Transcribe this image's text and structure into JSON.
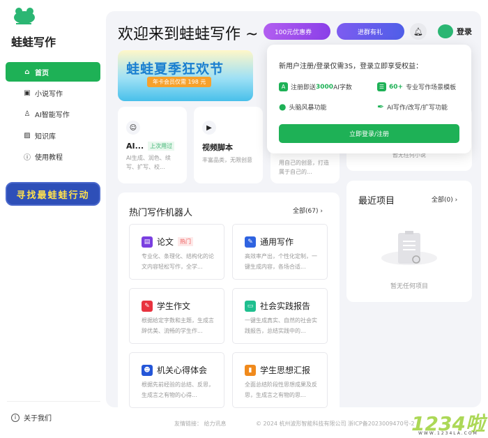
{
  "sidebar": {
    "brand": "蛙蛙写作",
    "items": [
      {
        "label": "首页",
        "icon": "home-icon"
      },
      {
        "label": "小说写作",
        "icon": "novel-icon"
      },
      {
        "label": "AI智能写作",
        "icon": "robot-icon"
      },
      {
        "label": "知识库",
        "icon": "image-icon"
      },
      {
        "label": "使用教程",
        "icon": "info-icon"
      }
    ],
    "promo": "寻找最蛙蛙行动",
    "about": "关于我们"
  },
  "header": {
    "title": "欢迎来到蛙蛙写作 ~",
    "coupon": "100元优惠券",
    "group": "进群有礼",
    "login": "登录"
  },
  "banner": {
    "title": "蛙蛙夏季狂欢节",
    "sub": "年卡会员仅需 198 元"
  },
  "quick": [
    {
      "name": "AI...",
      "tag": "上次用过",
      "desc": "AI生成、润色、续写、扩写、校..."
    },
    {
      "name": "视频脚本",
      "desc": "丰富品类，无限创意"
    },
    {
      "desc": "用自己的创意，打造属于自己的..."
    }
  ],
  "novel": {
    "empty": "暂无任何小说"
  },
  "hot": {
    "title": "热门写作机器人",
    "all": "全部(67)",
    "items": [
      {
        "name": "论文",
        "tag": "热门",
        "desc": "专业化、条理化、结构化的论文内容轻松写作，全学...",
        "color": "#7a3fe0"
      },
      {
        "name": "通用写作",
        "desc": "高效率产出，个性化定制，一键生成内容，各场合适...",
        "color": "#2f63e0"
      },
      {
        "name": "学生作文",
        "desc": "根据给定字数和主题，生成言辞优美、流畅的学生作...",
        "color": "#e8333f"
      },
      {
        "name": "社会实践报告",
        "desc": "一键生成真实、自然的社会实践报告，总结实践中的...",
        "color": "#1fbf8f"
      },
      {
        "name": "机关心得体会",
        "desc": "根据先前经验的总结、反思，生成言之有物的心得...",
        "color": "#2456d8"
      },
      {
        "name": "学生思想汇报",
        "desc": "全面总结阶段性思想成果及反思，生成言之有物的思...",
        "color": "#f08a1c"
      }
    ]
  },
  "recent": {
    "title": "最近项目",
    "all": "全部(0)",
    "empty": "暂无任何项目"
  },
  "popup": {
    "heading": "新用户注册/登录仅需3S，登录立即享受权益：",
    "f1a": "注册即送",
    "f1b": "3000",
    "f1c": "AI字数",
    "f2a": "60+",
    "f2b": "专业写作场景模板",
    "f3": "头脑风暴功能",
    "f4": "AI写作/改写/扩写功能",
    "cta": "立即登录/注册"
  },
  "footer": {
    "links_label": "友情链接：",
    "link": "给力讯息",
    "copyright": "© 2024 杭州波形智能科技有限公司 浙ICP备2023009470号-2"
  },
  "watermark": {
    "text": "1234啦",
    "url": "WWW.1234LA.COM"
  },
  "colors": {
    "accent": "#1eb156",
    "main_bg": "#f3f4f8"
  }
}
